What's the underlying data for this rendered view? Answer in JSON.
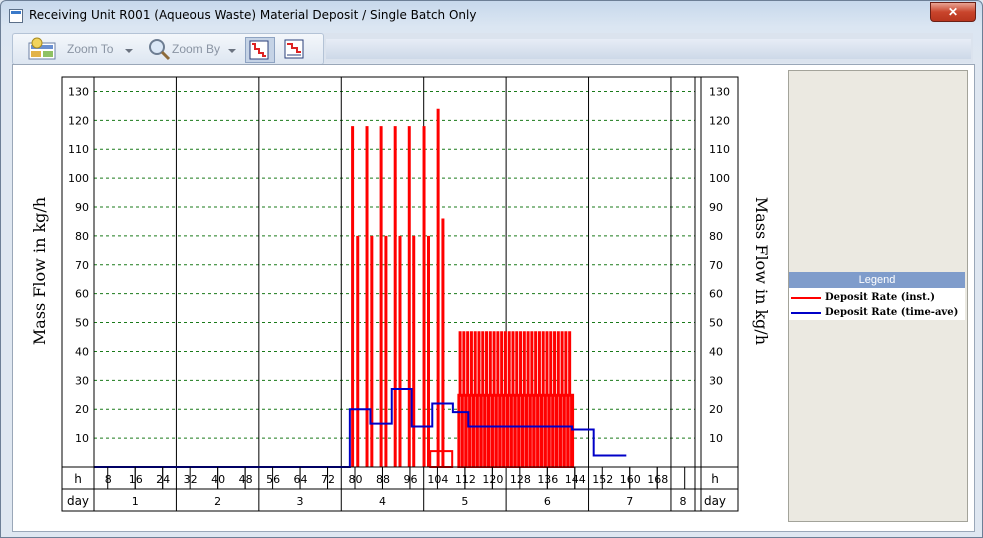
{
  "window": {
    "title": "Receiving Unit R001 (Aqueous Waste) Material Deposit / Single Batch Only",
    "close_glyph": "✕"
  },
  "toolbar": {
    "zoom_to_label": "Zoom To",
    "zoom_by_label": "Zoom By",
    "icons": [
      "chart-settings-icon",
      "magnifier-icon",
      "step-chart-icon",
      "step-chart-alt-icon"
    ]
  },
  "legend": {
    "title": "Legend",
    "items": [
      {
        "label": "Deposit Rate (inst.)",
        "color": "#ff0000"
      },
      {
        "label": "Deposit Rate (time-ave)",
        "color": "#0000c8"
      }
    ]
  },
  "chart_data": {
    "type": "line",
    "ylabel": "Mass Flow in kg/h",
    "xlabel_hours": "h",
    "xlabel_days": "day",
    "xlim": [
      0,
      175
    ],
    "ylim": [
      0,
      135
    ],
    "yticks": [
      10,
      20,
      30,
      40,
      50,
      60,
      70,
      80,
      90,
      100,
      110,
      120,
      130
    ],
    "xticks_hours": [
      8,
      16,
      24,
      32,
      40,
      48,
      56,
      64,
      72,
      80,
      88,
      96,
      104,
      112,
      120,
      128,
      136,
      144,
      152,
      160,
      168
    ],
    "day_labels": [
      "1",
      "2",
      "3",
      "4",
      "5",
      "6",
      "7",
      "8"
    ],
    "day_boundaries": [
      24,
      48,
      72,
      96,
      120,
      144,
      168
    ],
    "grid": {
      "horizontal": "dashed green",
      "vertical": "solid black at day boundaries"
    },
    "colors": {
      "inst": "#ff0000",
      "time_ave": "#0000c8",
      "grid": "#1a7a1a"
    },
    "series": [
      {
        "name": "Deposit Rate (inst.)",
        "style": "pulses",
        "pulses": [
          {
            "x": 75.3,
            "y": 118
          },
          {
            "x": 76.8,
            "y": 80
          },
          {
            "x": 79.5,
            "y": 118
          },
          {
            "x": 80.9,
            "y": 80
          },
          {
            "x": 83.6,
            "y": 118
          },
          {
            "x": 85.0,
            "y": 80
          },
          {
            "x": 87.7,
            "y": 118
          },
          {
            "x": 89.1,
            "y": 80
          },
          {
            "x": 91.8,
            "y": 118
          },
          {
            "x": 93.1,
            "y": 80
          },
          {
            "x": 96.1,
            "y": 118
          },
          {
            "x": 97.4,
            "y": 80
          },
          {
            "x": 100.2,
            "y": 124
          },
          {
            "x": 101.6,
            "y": 86
          },
          {
            "x": 106.6,
            "y": 47
          },
          {
            "x": 107.7,
            "y": 47
          },
          {
            "x": 108.8,
            "y": 47
          },
          {
            "x": 109.9,
            "y": 47
          },
          {
            "x": 111.0,
            "y": 47
          },
          {
            "x": 112.1,
            "y": 47
          },
          {
            "x": 113.2,
            "y": 47
          },
          {
            "x": 114.3,
            "y": 47
          },
          {
            "x": 115.4,
            "y": 47
          },
          {
            "x": 116.5,
            "y": 47
          },
          {
            "x": 117.6,
            "y": 47
          },
          {
            "x": 118.7,
            "y": 47
          },
          {
            "x": 119.8,
            "y": 47
          },
          {
            "x": 120.9,
            "y": 47
          },
          {
            "x": 122.0,
            "y": 47
          },
          {
            "x": 123.1,
            "y": 47
          },
          {
            "x": 124.2,
            "y": 47
          },
          {
            "x": 125.3,
            "y": 47
          },
          {
            "x": 126.4,
            "y": 47
          },
          {
            "x": 127.5,
            "y": 47
          },
          {
            "x": 128.6,
            "y": 47
          },
          {
            "x": 129.7,
            "y": 47
          },
          {
            "x": 130.8,
            "y": 47
          },
          {
            "x": 131.9,
            "y": 47
          },
          {
            "x": 133.0,
            "y": 47
          },
          {
            "x": 134.1,
            "y": 47
          },
          {
            "x": 135.2,
            "y": 47
          },
          {
            "x": 136.3,
            "y": 47
          },
          {
            "x": 137.4,
            "y": 47
          },
          {
            "x": 138.5,
            "y": 47
          }
        ],
        "blocks": [
          {
            "x0": 97.9,
            "x1": 104.3,
            "y": 5.5
          },
          {
            "x0": 106.1,
            "x1": 139.5,
            "y": 25
          }
        ]
      },
      {
        "name": "Deposit Rate (time-ave)",
        "style": "step",
        "x": [
          0,
          74.5,
          74.5,
          80.5,
          80.5,
          86.7,
          86.7,
          92.5,
          92.5,
          98.5,
          98.5,
          104.5,
          104.5,
          109,
          109,
          139.2,
          139.2,
          145.5,
          145.5,
          155
        ],
        "y": [
          0,
          0,
          20,
          20,
          15,
          15,
          27,
          27,
          14,
          14,
          22,
          22,
          19,
          19,
          14,
          14,
          13,
          13,
          4,
          4
        ]
      }
    ]
  }
}
